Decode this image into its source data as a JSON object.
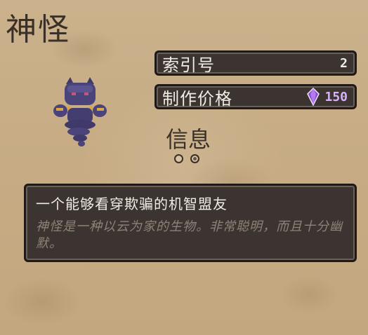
{
  "title": "神怪",
  "index": {
    "label": "索引号",
    "value": "2"
  },
  "craft": {
    "label": "制作价格",
    "value": "150",
    "icon": "purple-gem-icon"
  },
  "info": {
    "label": "信息"
  },
  "description": {
    "headline": "一个能够看穿欺骗的机智盟友",
    "body": "神怪是一种以云为家的生物。非常聪明，而且十分幽默。"
  },
  "colors": {
    "panel": "#3b3431",
    "accent": "#d8b0ff",
    "text": "#f1ece2",
    "paper": "#c9b08a"
  }
}
